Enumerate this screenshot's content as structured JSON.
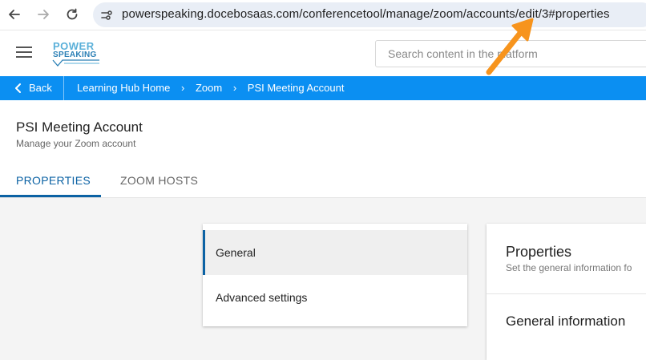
{
  "browser": {
    "url": "powerspeaking.docebosaas.com/conferencetool/manage/zoom/accounts/edit/3#properties"
  },
  "header": {
    "logo_line1": "POWER",
    "logo_line2": "SPEAKING",
    "search_placeholder": "Search content in the platform"
  },
  "breadcrumb": {
    "back_label": "Back",
    "items": [
      "Learning Hub Home",
      "Zoom",
      "PSI Meeting Account"
    ]
  },
  "page": {
    "title": "PSI Meeting Account",
    "subtitle": "Manage your Zoom account",
    "tabs": [
      {
        "label": "PROPERTIES",
        "active": true
      },
      {
        "label": "ZOOM HOSTS",
        "active": false
      }
    ]
  },
  "side_menu": {
    "items": [
      {
        "label": "General",
        "selected": true
      },
      {
        "label": "Advanced settings",
        "selected": false
      }
    ]
  },
  "properties_card": {
    "title": "Properties",
    "subtitle": "Set the general information fo",
    "section_title": "General information"
  },
  "colors": {
    "accent_blue": "#0b8ff2",
    "tab_active": "#0b62a4",
    "annotation_arrow": "#f7941d"
  }
}
